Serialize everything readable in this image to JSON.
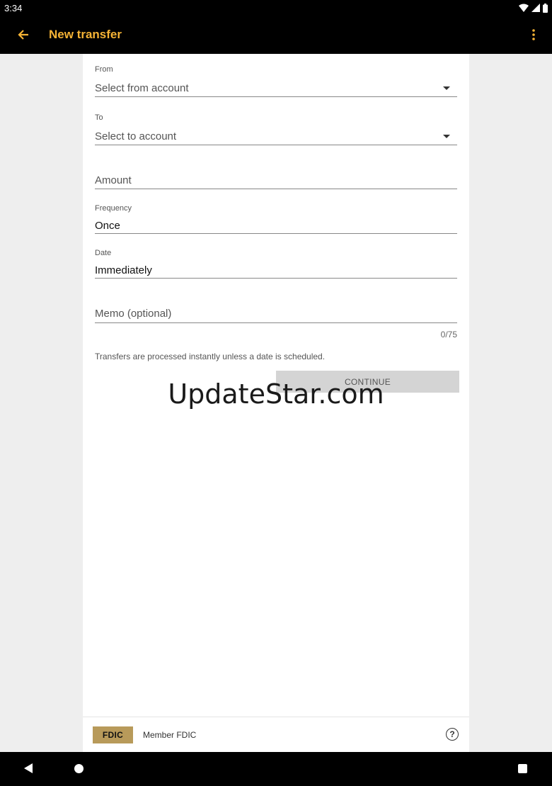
{
  "status_bar": {
    "time": "3:34"
  },
  "app_bar": {
    "title": "New transfer",
    "title_color": "#f5b335"
  },
  "form": {
    "from": {
      "label": "From",
      "placeholder": "Select from account"
    },
    "to": {
      "label": "To",
      "placeholder": "Select to account"
    },
    "amount": {
      "placeholder": "Amount"
    },
    "frequency": {
      "label": "Frequency",
      "value": "Once"
    },
    "date": {
      "label": "Date",
      "value": "Immediately"
    },
    "memo": {
      "placeholder": "Memo (optional)",
      "counter": "0/75"
    },
    "hint": "Transfers are processed instantly unless a date is scheduled.",
    "continue_label": "CONTINUE"
  },
  "watermark": "UpdateStar.com",
  "footer": {
    "logo_text": "FDIC",
    "member_text": "Member FDIC",
    "help_icon": "help-circle-icon"
  },
  "icons": {
    "back": "arrow-left-icon",
    "menu": "more-vert-icon",
    "wifi": "wifi-icon",
    "signal": "signal-icon",
    "battery": "battery-icon"
  }
}
